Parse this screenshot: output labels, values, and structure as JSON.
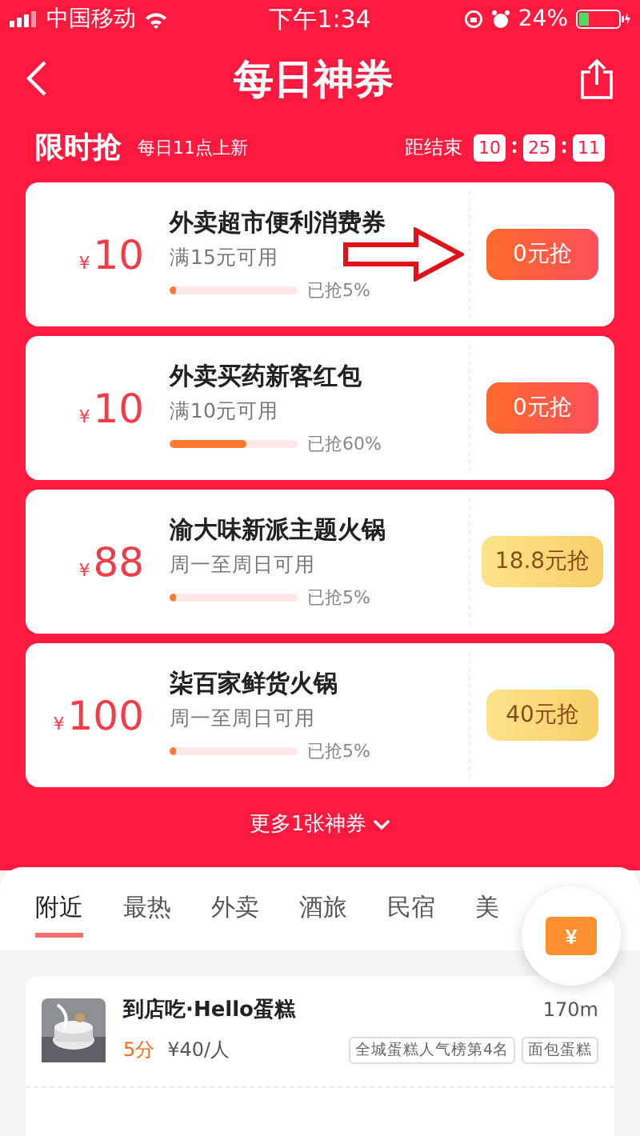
{
  "status_bar": {
    "carrier": "中国移动",
    "time": "下午1:34",
    "battery_text": "24%"
  },
  "header": {
    "title": "每日神券"
  },
  "section": {
    "title": "限时抢",
    "subtitle": "每日11点上新",
    "countdown_label": "距结束",
    "countdown": [
      "10",
      "25",
      "11"
    ]
  },
  "coupons": [
    {
      "currency": "¥",
      "amount": "10",
      "name": "外卖超市便利消费券",
      "condition": "满15元可用",
      "level": 0.05,
      "progress_text": "已抢5%",
      "button": "0元抢",
      "kind": "free",
      "annotated": true
    },
    {
      "currency": "¥",
      "amount": "10",
      "name": "外卖买药新客红包",
      "condition": "满10元可用",
      "level": 0.6,
      "progress_text": "已抢60%",
      "button": "0元抢",
      "kind": "free",
      "annotated": false
    },
    {
      "currency": "¥",
      "amount": "88",
      "name": "渝大味新派主题火锅",
      "condition": "周一至周日可用",
      "level": 0.05,
      "progress_text": "已抢5%",
      "button": "18.8元抢",
      "kind": "paid",
      "annotated": false
    },
    {
      "currency": "¥",
      "amount": "100",
      "name": "柒百家鲜货火锅",
      "condition": "周一至周日可用",
      "level": 0.05,
      "progress_text": "已抢5%",
      "button": "40元抢",
      "kind": "paid",
      "annotated": false
    }
  ],
  "more_link": "更多1张神券",
  "tabs": [
    {
      "label": "附近",
      "selected": true
    },
    {
      "label": "最热",
      "selected": false
    },
    {
      "label": "外卖",
      "selected": false
    },
    {
      "label": "酒旅",
      "selected": false
    },
    {
      "label": "民宿",
      "selected": false
    },
    {
      "label": "美",
      "selected": false
    }
  ],
  "floating_button": {
    "label": "¥"
  },
  "shops": [
    {
      "name": "到店吃·Hello蛋糕",
      "distance": "170m",
      "score": "5分",
      "price": "¥40/人",
      "tags": [
        "全城蛋糕人气榜第4名",
        "面包蛋糕"
      ]
    }
  ]
}
